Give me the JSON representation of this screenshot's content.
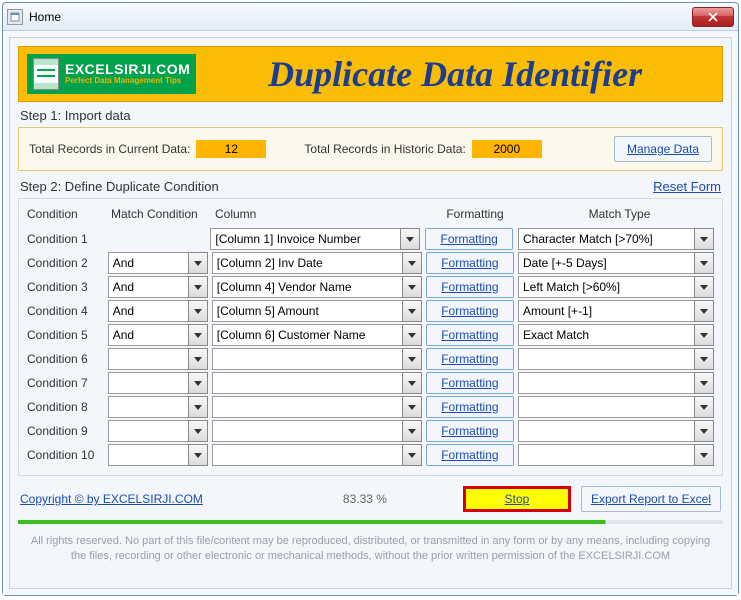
{
  "window": {
    "title": "Home"
  },
  "header": {
    "brand": "EXCELSIRJI.COM",
    "tagline": "Perfect Data Management Tips",
    "app_title": "Duplicate Data Identifier"
  },
  "step1": {
    "label": "Step 1: Import data",
    "current_label": "Total Records in Current Data:",
    "current_value": "12",
    "historic_label": "Total Records in Historic Data:",
    "historic_value": "2000",
    "manage_btn": "Manage Data"
  },
  "step2": {
    "label": "Step 2: Define Duplicate Condition",
    "reset": "Reset Form"
  },
  "columns": {
    "cond": "Condition",
    "match": "Match Condition",
    "column": "Column",
    "fmt": "Formatting",
    "type": "Match Type"
  },
  "fmt_label": "Formatting",
  "rows": [
    {
      "label": "Condition 1",
      "match": "",
      "column": "[Column 1] Invoice Number",
      "type": "Character Match [>70%]"
    },
    {
      "label": "Condition 2",
      "match": "And",
      "column": "[Column 2] Inv Date",
      "type": "Date [+-5 Days]"
    },
    {
      "label": "Condition 3",
      "match": "And",
      "column": "[Column 4] Vendor Name",
      "type": "Left Match [>60%]"
    },
    {
      "label": "Condition 4",
      "match": "And",
      "column": "[Column 5] Amount",
      "type": "Amount [+-1]"
    },
    {
      "label": "Condition 5",
      "match": "And",
      "column": "[Column 6] Customer Name",
      "type": "Exact Match"
    },
    {
      "label": "Condition 6",
      "match": "",
      "column": "",
      "type": ""
    },
    {
      "label": "Condition 7",
      "match": "",
      "column": "",
      "type": ""
    },
    {
      "label": "Condition 8",
      "match": "",
      "column": "",
      "type": ""
    },
    {
      "label": "Condition 9",
      "match": "",
      "column": "",
      "type": ""
    },
    {
      "label": "Condition 10",
      "match": "",
      "column": "",
      "type": ""
    }
  ],
  "footer": {
    "copyright": "Copyright © by EXCELSIRJI.COM",
    "percent": "83.33 %",
    "stop": "Stop",
    "export": "Export Report to Excel",
    "disclaimer": "All rights reserved. No part of this file/content may be reproduced, distributed, or transmitted in any form or by any means, including copying the files, recording or other electronic or mechanical methods, without the prior written permission of the EXCELSIRJI.COM"
  }
}
